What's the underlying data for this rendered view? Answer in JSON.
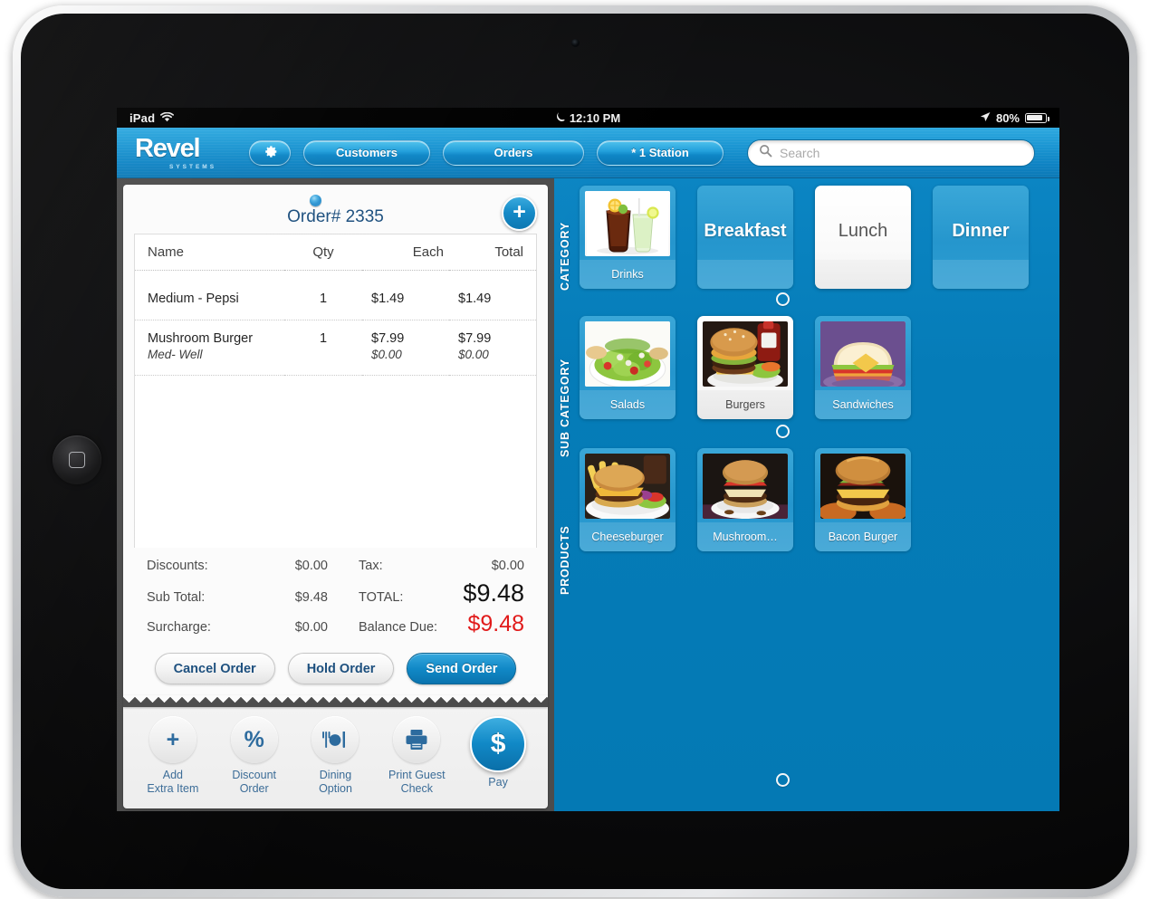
{
  "status_bar": {
    "device": "iPad",
    "wifi_icon": "wifi-icon",
    "moon_icon": "moon-icon",
    "time": "12:10 PM",
    "location_icon": "location-arrow-icon",
    "battery_percent": "80%"
  },
  "topnav": {
    "logo_word": "Revel",
    "logo_sub": "SYSTEMS",
    "gear_icon": "gear-icon",
    "customers_label": "Customers",
    "orders_label": "Orders",
    "station_label": "* 1 Station",
    "search_placeholder": "Search",
    "search_value": "",
    "search_icon": "search-icon"
  },
  "order": {
    "title": "Order# 2335",
    "add_item_glyph": "+",
    "columns": {
      "name": "Name",
      "qty": "Qty",
      "each": "Each",
      "total": "Total"
    },
    "items": [
      {
        "name": "Medium - Pepsi",
        "qty": "1",
        "each": "$1.49",
        "total": "$1.49",
        "modifier": null
      },
      {
        "name": "Mushroom Burger",
        "qty": "1",
        "each": "$7.99",
        "total": "$7.99",
        "modifier": {
          "name": "Med- Well",
          "qty": "",
          "each": "$0.00",
          "total": "$0.00"
        }
      }
    ],
    "totals": {
      "discounts_label": "Discounts:",
      "discounts_value": "$0.00",
      "tax_label": "Tax:",
      "tax_value": "$0.00",
      "subtotal_label": "Sub Total:",
      "subtotal_value": "$9.48",
      "total_label": "TOTAL:",
      "total_value": "$9.48",
      "surcharge_label": "Surcharge:",
      "surcharge_value": "$0.00",
      "balance_label": "Balance Due:",
      "balance_value": "$9.48"
    },
    "actions": {
      "cancel": "Cancel Order",
      "hold": "Hold Order",
      "send": "Send Order"
    }
  },
  "toolbar": {
    "items": [
      {
        "icon": "plus-icon",
        "glyph": "+",
        "line1": "Add",
        "line2": "Extra Item"
      },
      {
        "icon": "percent-icon",
        "glyph": "%",
        "line1": "Discount",
        "line2": "Order"
      },
      {
        "icon": "dining-icon",
        "glyph": "",
        "line1": "Dining",
        "line2": "Option"
      },
      {
        "icon": "printer-icon",
        "glyph": "",
        "line1": "Print Guest",
        "line2": "Check"
      },
      {
        "icon": "dollar-icon",
        "glyph": "$",
        "line1": "Pay",
        "line2": ""
      }
    ]
  },
  "menu": {
    "section_labels": {
      "category": "CATEGORY",
      "subcategory": "SUB CATEGORY",
      "products": "PRODUCTS"
    },
    "categories": [
      {
        "label": "Drinks",
        "image": "drinks-image",
        "selected": false,
        "text_only": false
      },
      {
        "label": "Breakfast",
        "image": null,
        "selected": false,
        "text_only": true
      },
      {
        "label": "Lunch",
        "image": null,
        "selected": true,
        "text_only": true
      },
      {
        "label": "Dinner",
        "image": null,
        "selected": false,
        "text_only": true
      }
    ],
    "subcategories": [
      {
        "label": "Salads",
        "image": "salad-image",
        "selected": false
      },
      {
        "label": "Burgers",
        "image": "burger-image",
        "selected": true
      },
      {
        "label": "Sandwiches",
        "image": "sandwich-image",
        "selected": false
      }
    ],
    "products": [
      {
        "label": "Cheeseburger",
        "image": "cheeseburger-image",
        "selected": false
      },
      {
        "label": "Mushroom…",
        "image": "mushroomburger-image",
        "selected": false
      },
      {
        "label": "Bacon Burger",
        "image": "baconburger-image",
        "selected": false
      }
    ]
  },
  "colors": {
    "brand_blue": "#0479b4",
    "nav_blue": "#1b96d2",
    "accent_red": "#e11b1b",
    "link_blue": "#1c4f7e"
  }
}
